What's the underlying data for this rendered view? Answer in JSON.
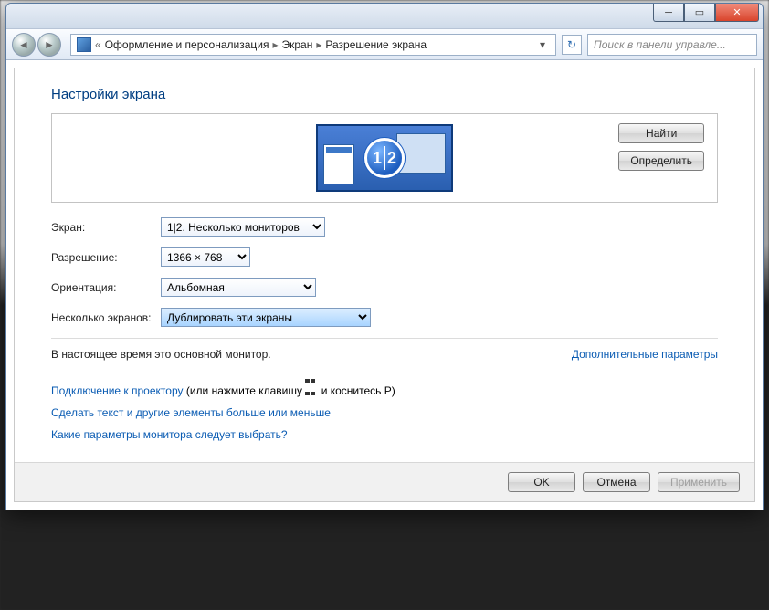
{
  "titlebar": {
    "minimize": "─",
    "maximize": "▭",
    "close": "✕"
  },
  "navbar": {
    "back_chevrons": "«",
    "crumbs": [
      "Оформление и персонализация",
      "Экран",
      "Разрешение экрана"
    ],
    "crumb_sep": "▸",
    "dropdown_glyph": "▾",
    "refresh_glyph": "↻",
    "search_placeholder": "Поиск в панели управле..."
  },
  "main": {
    "heading": "Настройки экрана",
    "detect_btn": "Найти",
    "identify_btn": "Определить",
    "preview_numbers": [
      "1",
      "2"
    ],
    "labels": {
      "display": "Экран:",
      "resolution": "Разрешение:",
      "orientation": "Ориентация:",
      "multi": "Несколько экранов:"
    },
    "values": {
      "display": "1|2. Несколько мониторов",
      "resolution": "1366 × 768",
      "orientation": "Альбомная",
      "multi": "Дублировать эти экраны"
    },
    "status_text": "В настоящее время это основной монитор.",
    "advanced_link": "Дополнительные параметры",
    "projector_link": "Подключение к проектору",
    "projector_suffix_a": " (или нажмите клавишу ",
    "projector_suffix_b": " и коснитесь P)",
    "textsize_link": "Сделать текст и другие элементы больше или меньше",
    "help_link": "Какие параметры монитора следует выбрать?"
  },
  "footer": {
    "ok": "OK",
    "cancel": "Отмена",
    "apply": "Применить"
  }
}
